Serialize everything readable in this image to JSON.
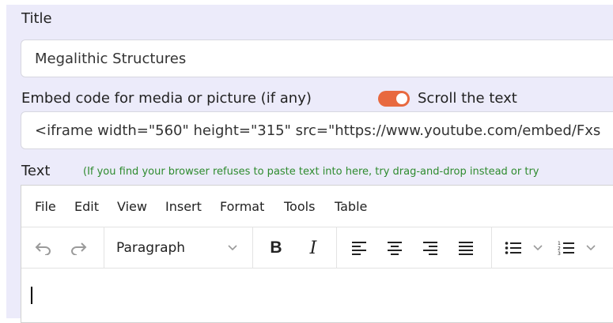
{
  "form": {
    "title_label": "Title",
    "title_value": "Megalithic Structures",
    "embed_label": "Embed code for media or picture (if any)",
    "embed_value": "<iframe width=\"560\" height=\"315\" src=\"https://www.youtube.com/embed/Fxs",
    "scroll_toggle_label": "Scroll the text",
    "scroll_toggle_on": true,
    "text_label": "Text",
    "text_hint": "(If you find your browser refuses to paste text into here, try drag-and-drop instead or try"
  },
  "editor": {
    "menu": [
      "File",
      "Edit",
      "View",
      "Insert",
      "Format",
      "Tools",
      "Table"
    ],
    "block_format": "Paragraph",
    "toolbar_icons": [
      "undo-icon",
      "redo-icon",
      "bold-icon",
      "italic-icon",
      "align-left-icon",
      "align-center-icon",
      "align-right-icon",
      "align-justify-icon",
      "bullet-list-icon",
      "numbered-list-icon"
    ],
    "bold_glyph": "B",
    "italic_glyph": "I"
  },
  "colors": {
    "panel_bg": "#ecebfa",
    "toggle_on": "#e8693f",
    "hint_text": "#2e8b2e"
  }
}
